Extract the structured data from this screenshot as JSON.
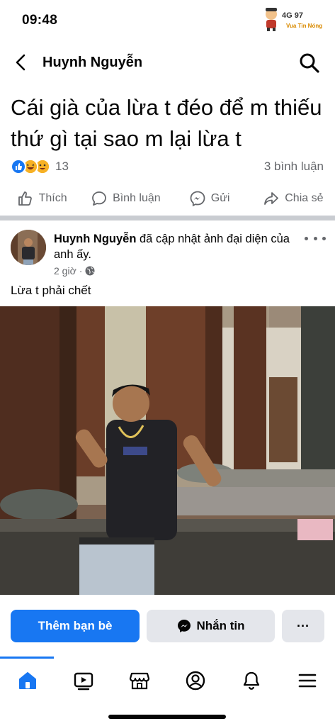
{
  "status_bar": {
    "time": "09:48",
    "watermark_main": "4G 97",
    "watermark_sub": "Vua Tin Nóng"
  },
  "nav": {
    "title": "Huynh Nguyễn",
    "back_icon": "chevron-left-icon",
    "search_icon": "search-icon"
  },
  "post": {
    "text": "Cái già của lừa t đéo để m thiếu thứ gì tại sao m lại lừa t",
    "reaction_count": "13",
    "reaction_types": [
      "like",
      "haha",
      "wow"
    ],
    "comment_count": "3 bình luận"
  },
  "actions": {
    "like": "Thích",
    "comment": "Bình luận",
    "send": "Gửi",
    "share": "Chia sẻ"
  },
  "profile_post": {
    "author": "Huynh Nguyễn",
    "action_text": " đã cập nhật ảnh đại diện của anh ấy.",
    "time": "2 giờ",
    "separator": "·",
    "caption": "Lừa t phải chết"
  },
  "profile_buttons": {
    "add_friend": "Thêm bạn bè",
    "message": "Nhắn tin",
    "more": "···"
  },
  "tabbar": {
    "tabs": [
      "home",
      "video",
      "marketplace",
      "profile",
      "notifications",
      "menu"
    ],
    "active": "home"
  },
  "colors": {
    "accent": "#1877f2",
    "secondary_text": "#65676b",
    "button_gray": "#e4e6eb"
  }
}
